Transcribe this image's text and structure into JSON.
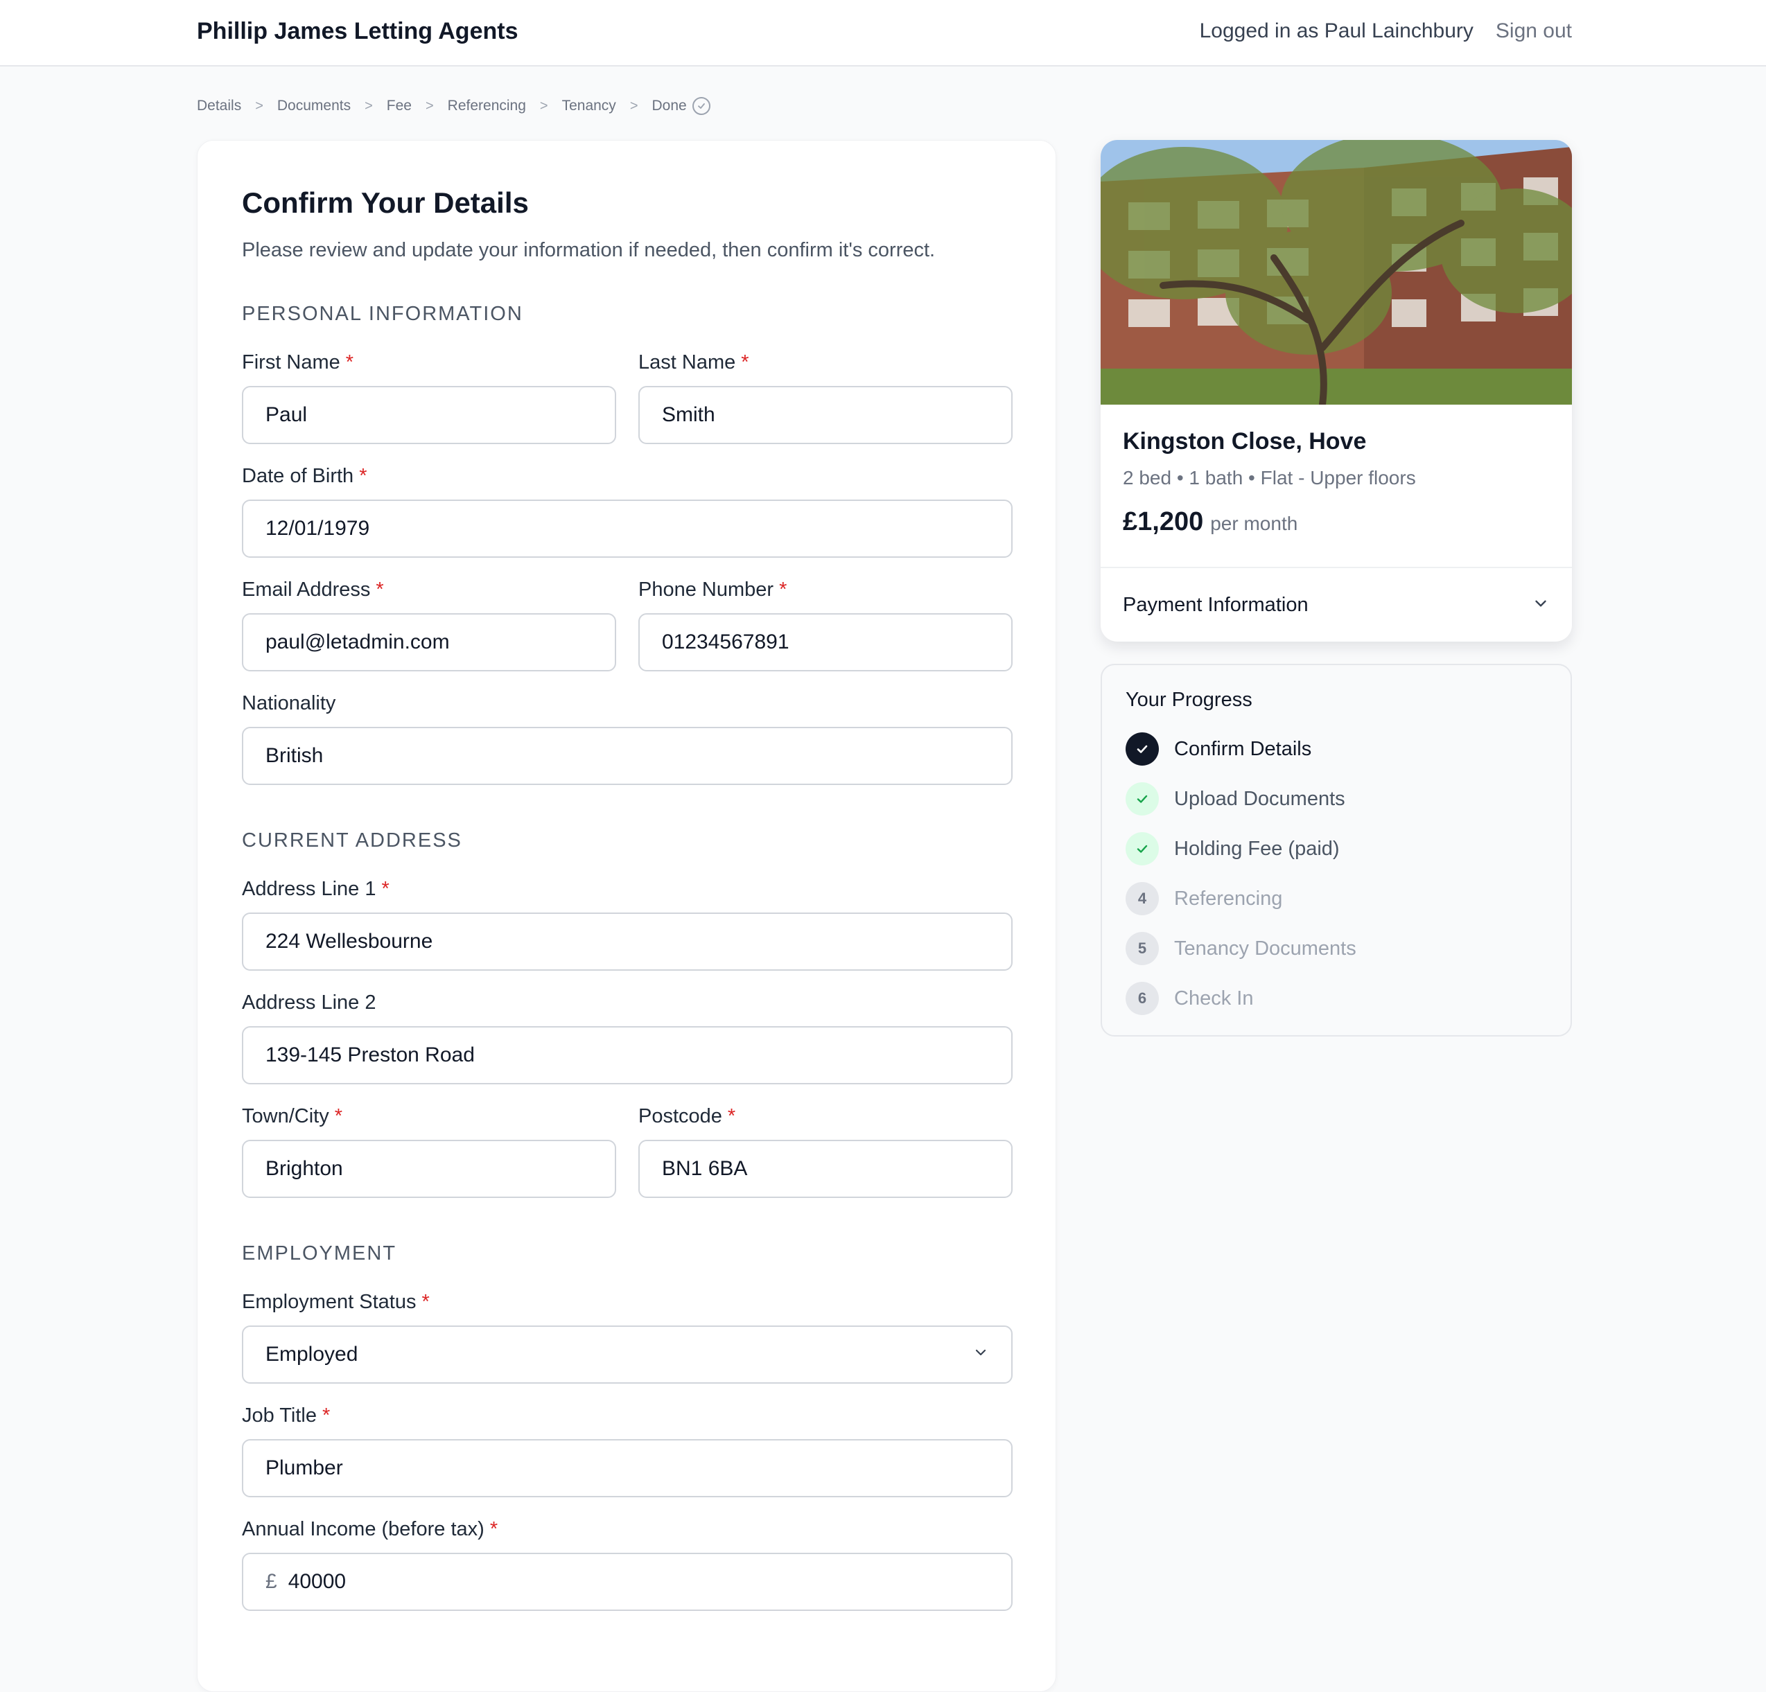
{
  "header": {
    "brand": "Phillip James Letting Agents",
    "logged_in": "Logged in as Paul Lainchbury",
    "sign_out": "Sign out"
  },
  "breadcrumb": {
    "items": [
      "Details",
      "Documents",
      "Fee",
      "Referencing",
      "Tenancy",
      "Done"
    ],
    "separator": ">"
  },
  "form": {
    "title": "Confirm Your Details",
    "subtitle": "Please review and update your information if needed, then confirm it's correct.",
    "required_marker": "*",
    "sections": {
      "personal": "PERSONAL INFORMATION",
      "address": "CURRENT ADDRESS",
      "employment": "EMPLOYMENT"
    },
    "fields": {
      "first_name": {
        "label": "First Name",
        "value": "Paul"
      },
      "last_name": {
        "label": "Last Name",
        "value": "Smith"
      },
      "dob": {
        "label": "Date of Birth",
        "value": "12/01/1979"
      },
      "email": {
        "label": "Email Address",
        "value": "paul@letadmin.com"
      },
      "phone": {
        "label": "Phone Number",
        "value": "01234567891"
      },
      "nationality": {
        "label": "Nationality",
        "value": "British"
      },
      "address1": {
        "label": "Address Line 1",
        "value": "224 Wellesbourne"
      },
      "address2": {
        "label": "Address Line 2",
        "value": "139-145 Preston Road"
      },
      "town": {
        "label": "Town/City",
        "value": "Brighton"
      },
      "postcode": {
        "label": "Postcode",
        "value": "BN1 6BA"
      },
      "employment_status": {
        "label": "Employment Status",
        "value": "Employed"
      },
      "job_title": {
        "label": "Job Title",
        "value": "Plumber"
      },
      "income": {
        "label": "Annual Income (before tax)",
        "currency": "£",
        "value": "40000"
      }
    }
  },
  "property": {
    "title": "Kingston Close, Hove",
    "specs": "2 bed • 1 bath • Flat - Upper floors",
    "price": "£1,200",
    "per": "per month",
    "payment_label": "Payment Information"
  },
  "progress": {
    "title": "Your Progress",
    "steps": [
      {
        "label": "Confirm Details",
        "state": "current"
      },
      {
        "label": "Upload Documents",
        "state": "done"
      },
      {
        "label": "Holding Fee (paid)",
        "state": "done"
      },
      {
        "label": "Referencing",
        "state": "pending",
        "number": "4"
      },
      {
        "label": "Tenancy Documents",
        "state": "pending",
        "number": "5"
      },
      {
        "label": "Check In",
        "state": "pending",
        "number": "6"
      }
    ]
  },
  "colors": {
    "accent": "#111827",
    "required": "#dc2626",
    "done_badge": "#dcfce7",
    "done_check": "#16a34a"
  }
}
